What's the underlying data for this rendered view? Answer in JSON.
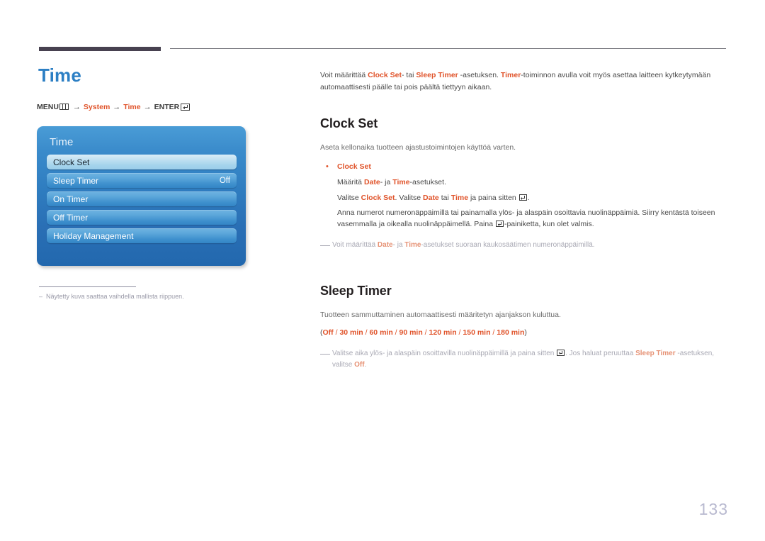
{
  "page": {
    "title": "Time",
    "number": "133",
    "accent_color": "#e0532a",
    "title_color": "#2c7fc4"
  },
  "breadcrumb": {
    "menu_label": "MENU",
    "menu_icon": "menu-grid-icon",
    "arrow": "→",
    "items": [
      "System",
      "Time"
    ],
    "enter_label": "ENTER",
    "enter_icon": "enter-return-icon"
  },
  "osd": {
    "title": "Time",
    "items": [
      {
        "label": "Clock Set",
        "value": "",
        "selected": true
      },
      {
        "label": "Sleep Timer",
        "value": "Off",
        "selected": false
      },
      {
        "label": "On Timer",
        "value": "",
        "selected": false
      },
      {
        "label": "Off Timer",
        "value": "",
        "selected": false
      },
      {
        "label": "Holiday Management",
        "value": "",
        "selected": false
      }
    ]
  },
  "caption": {
    "dash": "–",
    "text": "Näytetty kuva saattaa vaihdella mallista riippuen."
  },
  "intro": {
    "p1_a": "Voit määrittää ",
    "p1_b1": "Clock Set",
    "p1_c": "- tai ",
    "p1_b2": "Sleep Timer",
    "p1_d": " -asetuksen. ",
    "p1_b3": "Timer",
    "p1_e": "-toiminnon avulla voit myös asettaa laitteen kytkeytymään automaattisesti päälle tai pois päältä tiettyyn aikaan."
  },
  "clock_set": {
    "heading": "Clock Set",
    "description": "Aseta kellonaika tuotteen ajastustoimintojen käyttöä varten.",
    "bullet_label": "Clock Set",
    "line1_a": "Määritä ",
    "line1_b1": "Date",
    "line1_c": "- ja ",
    "line1_b2": "Time",
    "line1_d": "-asetukset.",
    "line2_a": "Valitse ",
    "line2_b1": "Clock Set",
    "line2_c": ". Valitse ",
    "line2_b2": "Date",
    "line2_d": " tai ",
    "line2_b3": "Time",
    "line2_e": " ja paina sitten ",
    "line2_f": ".",
    "line3_a": "Anna numerot numeronäppäimillä tai painamalla ylös- ja alaspäin osoittavia nuolinäppäimiä. Siirry kentästä toiseen vasemmalla ja oikealla nuolinäppäimellä. Paina ",
    "line3_b": "-painiketta, kun olet valmis.",
    "note_a": "Voit määrittää ",
    "note_b1": "Date",
    "note_c": "- ja ",
    "note_b2": "Time",
    "note_d": "-asetukset suoraan kaukosäätimen numeronäppäimillä."
  },
  "sleep_timer": {
    "heading": "Sleep Timer",
    "description": "Tuotteen sammuttaminen automaattisesti määritetyn ajanjakson kuluttua.",
    "options_open": "(",
    "options": [
      "Off",
      "30 min",
      "60 min",
      "90 min",
      "120 min",
      "150 min",
      "180 min"
    ],
    "options_sep": " / ",
    "options_close": ")",
    "note_a": "Valitse aika ylös- ja alaspäin osoittavilla nuolinäppäimillä ja paina sitten ",
    "note_b": ". Jos haluat peruuttaa ",
    "note_bold1": "Sleep Timer",
    "note_c": " -asetuksen, valitse ",
    "note_bold2": "Off",
    "note_d": "."
  }
}
